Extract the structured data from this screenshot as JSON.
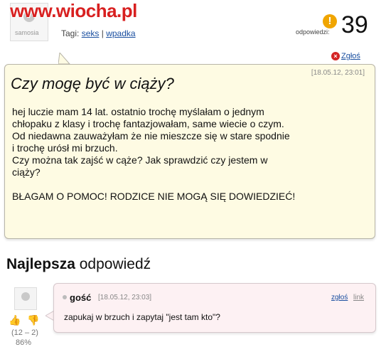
{
  "header": {
    "watermark": "www.wiocha.pl",
    "avatar_brand": "samosia",
    "tags_label": "Tagi:",
    "tags": [
      "seks",
      "wpadka"
    ],
    "tags_separator": "|",
    "answers_label": "odpowiedzi:",
    "answers_count": "39",
    "answers_icon": "!",
    "report_label": "Zgłoś"
  },
  "question": {
    "date": "[18.05.12, 23:01]",
    "title": "Czy mogę być w ciąży?",
    "body": "hej luczie mam 14 lat. ostatnio trochę myślałam o jednym\nchłopaku z klasy i trochę fantazjowałam, same wiecie o czym.\nOd niedawna zauważyłam że nie mieszcze się w stare spodnie\ni trochę urósł mi brzuch.\nCzy można tak zajść w cąże? Jak sprawdzić czy jestem w\nciąży?\n\nBŁAGAM O POMOC! RODZICE NIE MOGĄ SIĘ DOWIEDZIEĆ!"
  },
  "best_answer": {
    "heading_bold": "Najlepsza",
    "heading_rest": "odpowiedź",
    "author": "gość",
    "date": "[18.05.12, 23:03]",
    "report_label": "zgłoś",
    "link_label": "link",
    "body": "zapukaj w brzuch i zapytaj \"jest tam kto\"?",
    "votes": "(12 – 2)",
    "percent": "86%"
  },
  "colors": {
    "question_bg": "#fefbe3",
    "answer_bg": "#fdf1f3",
    "link": "#1a4fa0",
    "watermark": "#d82020",
    "answers_icon": "#f0a500",
    "report_icon": "#d42424"
  }
}
